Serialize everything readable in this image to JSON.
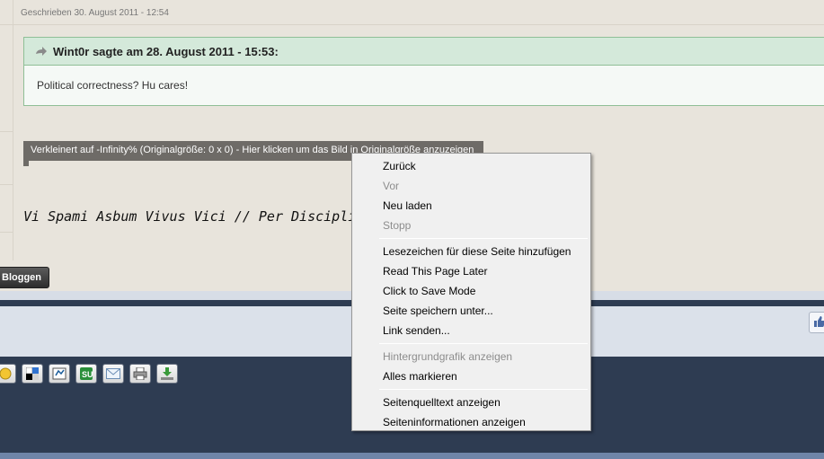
{
  "post": {
    "date": "Geschrieben 30. August 2011 - 12:54",
    "quote_author": "Wint0r sagte am 28. August 2011 - 15:53:",
    "quote_text": "Political correctness? Hu cares!",
    "resize_banner": "Verkleinert auf -Infinity% (Originalgröße: 0 x 0) - Hier klicken um das Bild in Originalgröße anzuzeigen",
    "signature": "Vi Spami Asbum Vivus Vici // Per Discipli"
  },
  "toolbar": {
    "bloggen_label": "Bloggen"
  },
  "icons": {
    "quote": "quote-arrow-icon",
    "like": "thumbs-up-icon",
    "share": [
      "smiley-icon",
      "delicious-icon",
      "digg-icon",
      "stumbleupon-icon",
      "email-icon",
      "print-icon",
      "download-icon"
    ]
  },
  "context_menu": {
    "items": [
      {
        "label": "Zurück",
        "disabled": false
      },
      {
        "label": "Vor",
        "disabled": true
      },
      {
        "label": "Neu laden",
        "disabled": false
      },
      {
        "label": "Stopp",
        "disabled": true
      },
      {
        "label": "Lesezeichen für diese Seite hinzufügen",
        "disabled": false
      },
      {
        "label": "Read This Page Later",
        "disabled": false
      },
      {
        "label": "Click to Save Mode",
        "disabled": false
      },
      {
        "label": "Seite speichern unter...",
        "disabled": false
      },
      {
        "label": "Link senden...",
        "disabled": false
      },
      {
        "label": "Hintergrundgrafik anzeigen",
        "disabled": true
      },
      {
        "label": "Alles markieren",
        "disabled": false
      },
      {
        "label": "Seitenquelltext anzeigen",
        "disabled": false
      },
      {
        "label": "Seiteninformationen anzeigen",
        "disabled": false
      }
    ]
  },
  "colors": {
    "page_bg": "#e8e4dc",
    "quote_border": "#8fbf96",
    "quote_header_bg": "#d4e9da",
    "footer_dark": "#2e3c52",
    "menu_bg": "#f0f0f0"
  }
}
